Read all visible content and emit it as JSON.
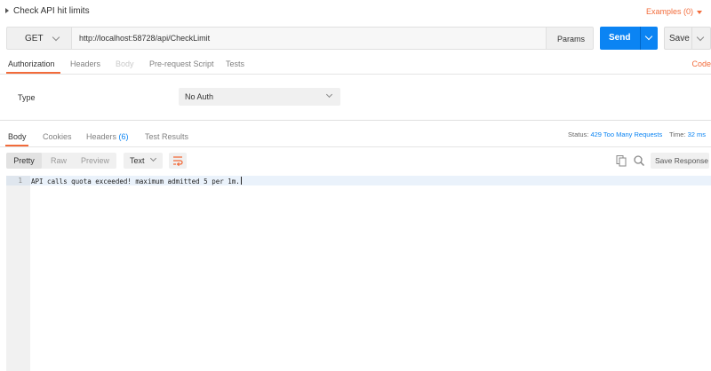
{
  "request": {
    "title": "Check API hit limits",
    "examples_label": "Examples (0)",
    "method": "GET",
    "url": "http://localhost:58728/api/CheckLimit",
    "params_label": "Params",
    "send_label": "Send",
    "save_label": "Save"
  },
  "request_tabs": {
    "authorization": "Authorization",
    "headers": "Headers",
    "body": "Body",
    "pre_request": "Pre-request Script",
    "tests": "Tests",
    "code": "Code"
  },
  "auth": {
    "type_label": "Type",
    "type_value": "No Auth"
  },
  "response_tabs": {
    "body": "Body",
    "cookies": "Cookies",
    "headers": "Headers",
    "headers_count": "(6)",
    "test_results": "Test Results",
    "status_label": "Status:",
    "status_value": "429 Too Many Requests",
    "time_label": "Time:",
    "time_value": "32 ms"
  },
  "response_toolbar": {
    "pretty": "Pretty",
    "raw": "Raw",
    "preview": "Preview",
    "format": "Text",
    "save_response": "Save Response"
  },
  "response_body": {
    "lines": [
      {
        "number": "1",
        "text": "API calls quota exceeded! maximum admitted 5 per 1m."
      }
    ]
  },
  "colors": {
    "accent": "#f26b3a",
    "send_blue": "#0b84f3"
  }
}
